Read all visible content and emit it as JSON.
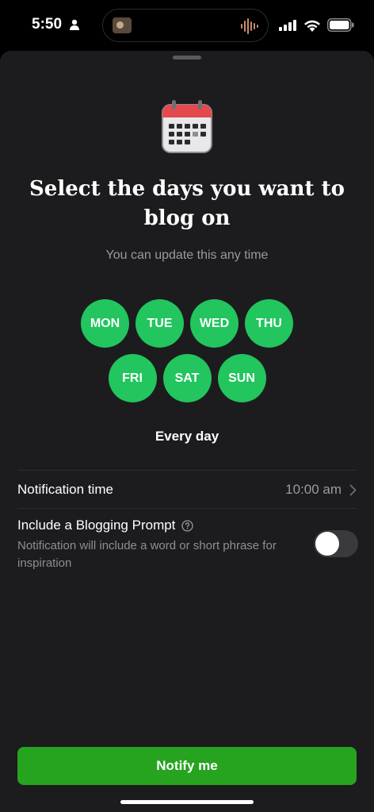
{
  "status_bar": {
    "time": "5:50",
    "icons": [
      "person-icon",
      "signal-icon",
      "wifi-icon",
      "battery-icon"
    ],
    "battery_level": 0.9
  },
  "dynamic_island": {
    "icons": [
      "now-playing-thumbnail",
      "audio-waveform-icon"
    ],
    "accent_color": "#c98a6a"
  },
  "sheet": {
    "header_icon": "calendar-icon",
    "title": "Select the days you want to blog on",
    "subtitle": "You can update this any time",
    "days": [
      {
        "label": "MON",
        "selected": true
      },
      {
        "label": "TUE",
        "selected": true
      },
      {
        "label": "WED",
        "selected": true
      },
      {
        "label": "THU",
        "selected": true
      },
      {
        "label": "FRI",
        "selected": true
      },
      {
        "label": "SAT",
        "selected": true
      },
      {
        "label": "SUN",
        "selected": true
      }
    ],
    "days_summary": "Every day",
    "notification_time": {
      "label": "Notification time",
      "value": "10:00 am",
      "icon": "chevron-right-icon"
    },
    "blogging_prompt": {
      "label": "Include a Blogging Prompt",
      "icon": "help-circle-icon",
      "description": "Notification will include a word or short phrase for inspiration",
      "enabled": false
    },
    "notify_button": "Notify me"
  },
  "colors": {
    "day_selected": "#22c55e",
    "primary_button": "#26a31f",
    "sheet_background": "#1c1c1e",
    "secondary_text": "#9a9a9f",
    "calendar_red": "#e5484d"
  }
}
